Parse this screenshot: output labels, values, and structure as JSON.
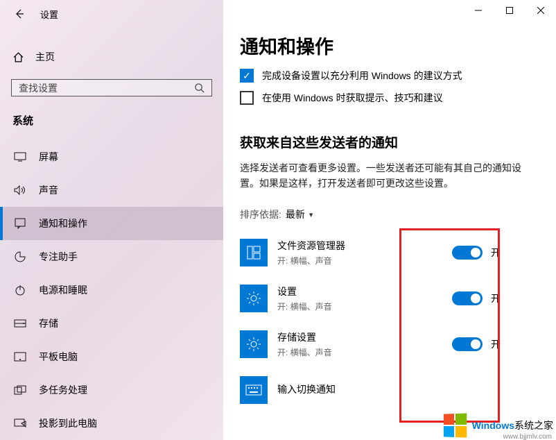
{
  "titlebar": {
    "title": "设置"
  },
  "home": {
    "label": "主页"
  },
  "search": {
    "placeholder": "查找设置"
  },
  "section": {
    "title": "系统"
  },
  "nav": [
    {
      "key": "display",
      "label": "屏幕"
    },
    {
      "key": "sound",
      "label": "声音"
    },
    {
      "key": "notifications",
      "label": "通知和操作",
      "selected": true
    },
    {
      "key": "focus",
      "label": "专注助手"
    },
    {
      "key": "power",
      "label": "电源和睡眠"
    },
    {
      "key": "storage",
      "label": "存储"
    },
    {
      "key": "tablet",
      "label": "平板电脑"
    },
    {
      "key": "multitask",
      "label": "多任务处理"
    },
    {
      "key": "project",
      "label": "投影到此电脑"
    }
  ],
  "page": {
    "title": "通知和操作",
    "checks": [
      {
        "label": "完成设备设置以充分利用 Windows 的建议方式",
        "checked": true
      },
      {
        "label": "在使用 Windows 时获取提示、技巧和建议",
        "checked": false
      }
    ],
    "senders_heading": "获取来自这些发送者的通知",
    "senders_desc": "选择发送者可查看更多设置。一些发送者还可能有其自己的通知设置。如果是这样，打开发送者即可更改这些设置。",
    "sort_label": "排序依据:",
    "sort_value": "最新",
    "toggle_on": "开",
    "senders": [
      {
        "name": "文件资源管理器",
        "sub": "开: 横幅、声音",
        "icon": "explorer",
        "on": true
      },
      {
        "name": "设置",
        "sub": "开: 横幅、声音",
        "icon": "gear",
        "on": true
      },
      {
        "name": "存储设置",
        "sub": "开: 横幅、声音",
        "icon": "gear",
        "on": true
      },
      {
        "name": "输入切换通知",
        "sub": "",
        "icon": "keyboard",
        "on": true
      }
    ]
  },
  "watermark": {
    "brand": "Windows",
    "text": "系统之家",
    "url": "www.bjjmlv.com"
  }
}
